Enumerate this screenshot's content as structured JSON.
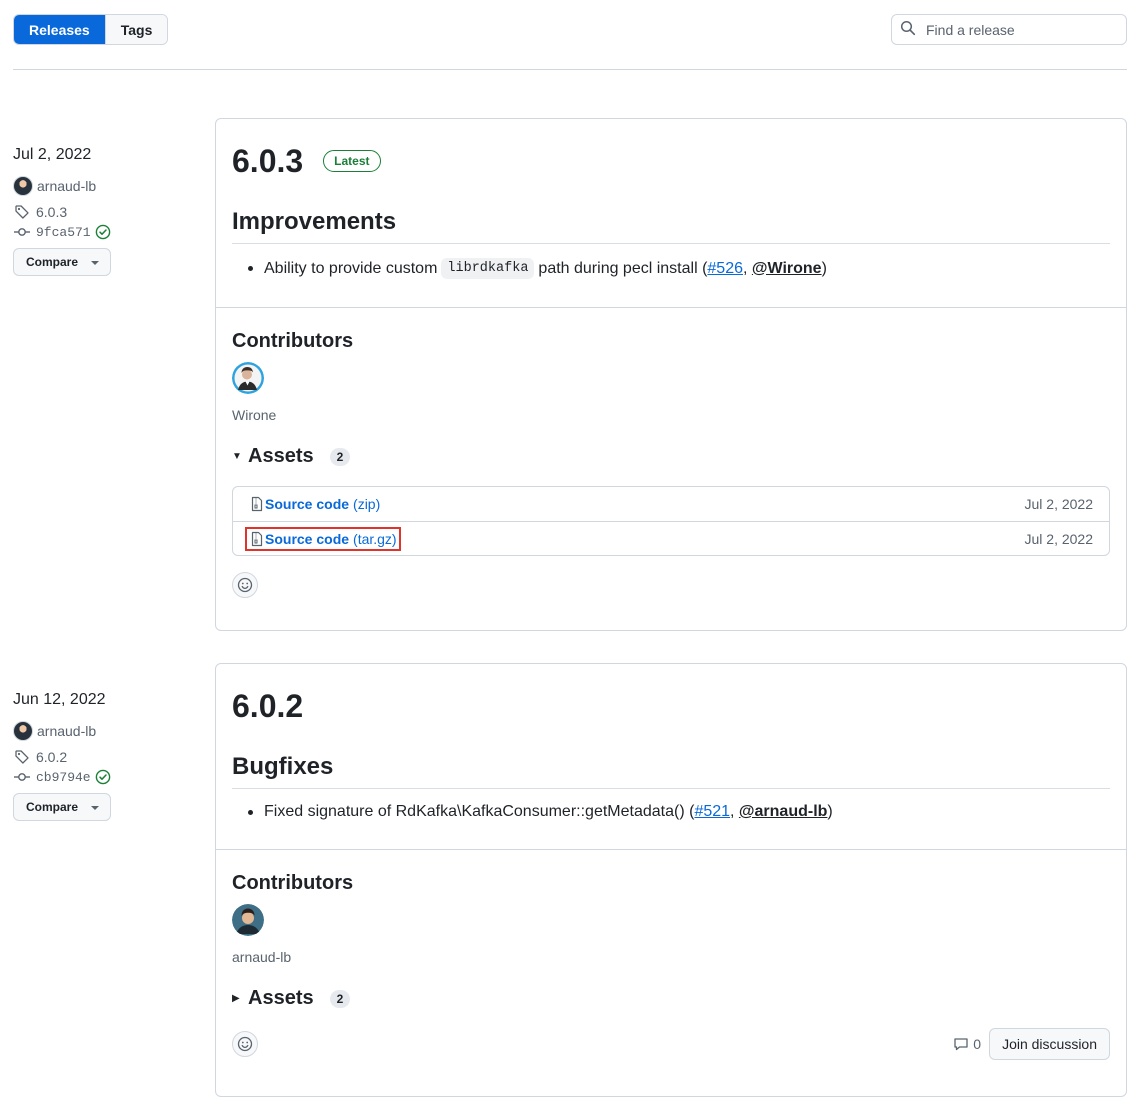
{
  "tabs": {
    "releases": "Releases",
    "tags": "Tags"
  },
  "search": {
    "placeholder": "Find a release"
  },
  "releases": [
    {
      "date": "Jul 2, 2022",
      "author": "arnaud-lb",
      "tag": "6.0.3",
      "commit": "9fca571",
      "compare_label": "Compare",
      "version": "6.0.3",
      "badge": "Latest",
      "section_heading": "Improvements",
      "note": {
        "before": "Ability to provide custom",
        "code": "librdkafka",
        "after": "path during pecl install (",
        "pr": "#526",
        "sep": ", ",
        "mention": "@Wirone",
        "close": ")"
      },
      "contributors_heading": "Contributors",
      "contributor": "Wirone",
      "assets_heading": "Assets",
      "assets_count": "2",
      "assets": [
        {
          "name": "Source code",
          "ext": "(zip)",
          "date": "Jul 2, 2022"
        },
        {
          "name": "Source code",
          "ext": "(tar.gz)",
          "date": "Jul 2, 2022"
        }
      ]
    },
    {
      "date": "Jun 12, 2022",
      "author": "arnaud-lb",
      "tag": "6.0.2",
      "commit": "cb9794e",
      "compare_label": "Compare",
      "version": "6.0.2",
      "section_heading": "Bugfixes",
      "note": {
        "before": "Fixed signature of RdKafka\\KafkaConsumer::getMetadata() (",
        "pr": "#521",
        "sep": ", ",
        "mention": "@arnaud-lb",
        "close": ")"
      },
      "contributors_heading": "Contributors",
      "contributor": "arnaud-lb",
      "assets_heading": "Assets",
      "assets_count": "2",
      "comments_count": "0",
      "join_label": "Join discussion"
    }
  ],
  "colors": {
    "accent": "#0969da",
    "success": "#1a7f37",
    "highlight": "#e0342a"
  }
}
